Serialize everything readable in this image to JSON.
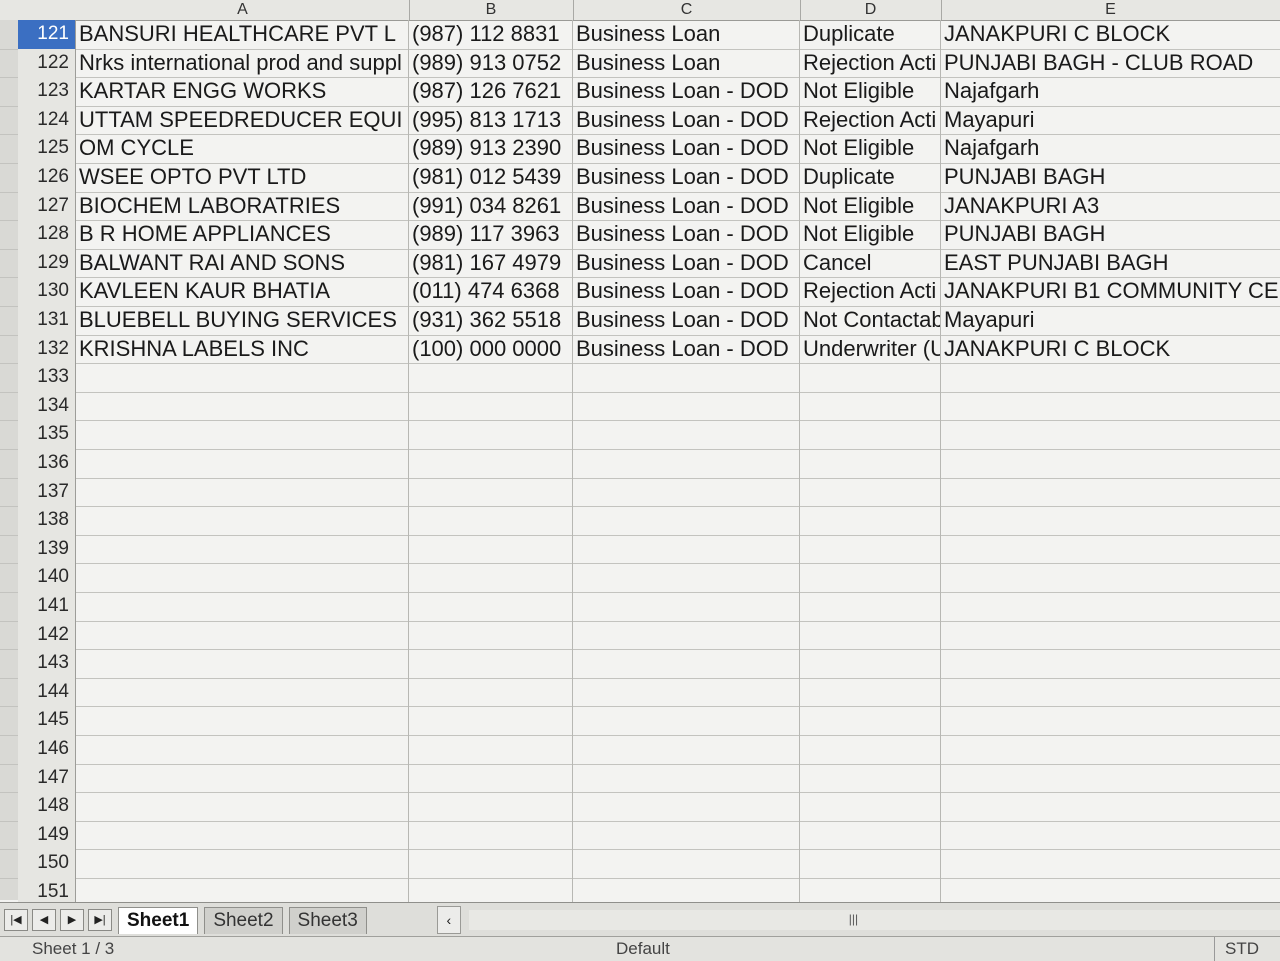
{
  "columns": [
    "A",
    "B",
    "C",
    "D",
    "E"
  ],
  "rows": [
    {
      "num": "121",
      "a": "BANSURI HEALTHCARE PVT L",
      "b": "(987) 112 8831",
      "c": "Business Loan",
      "d": "Duplicate",
      "e": "JANAKPURI C BLOCK",
      "active": true
    },
    {
      "num": "122",
      "a": "Nrks international prod and suppl",
      "b": "(989) 913 0752",
      "c": "Business Loan",
      "d": "Rejection Acti",
      "e": "PUNJABI BAGH - CLUB ROAD"
    },
    {
      "num": "123",
      "a": "KARTAR ENGG WORKS",
      "b": "(987) 126 7621",
      "c": "Business Loan - DOD",
      "d": "Not Eligible",
      "e": "Najafgarh"
    },
    {
      "num": "124",
      "a": "UTTAM SPEEDREDUCER EQUI",
      "b": "(995) 813 1713",
      "c": "Business Loan - DOD",
      "d": "Rejection Acti",
      "e": "Mayapuri"
    },
    {
      "num": "125",
      "a": "OM CYCLE",
      "b": "(989) 913 2390",
      "c": "Business Loan - DOD",
      "d": "Not Eligible",
      "e": "Najafgarh"
    },
    {
      "num": "126",
      "a": "WSEE OPTO PVT LTD",
      "b": "(981) 012 5439",
      "c": "Business Loan - DOD",
      "d": "Duplicate",
      "e": "PUNJABI BAGH"
    },
    {
      "num": "127",
      "a": "BIOCHEM LABORATRIES",
      "b": "(991) 034 8261",
      "c": "Business Loan - DOD",
      "d": "Not Eligible",
      "e": "JANAKPURI A3"
    },
    {
      "num": "128",
      "a": "B R HOME APPLIANCES",
      "b": "(989) 117 3963",
      "c": "Business Loan - DOD",
      "d": "Not Eligible",
      "e": "PUNJABI BAGH"
    },
    {
      "num": "129",
      "a": "BALWANT RAI AND SONS",
      "b": "(981) 167 4979",
      "c": "Business Loan - DOD",
      "d": "Cancel",
      "e": "EAST PUNJABI BAGH"
    },
    {
      "num": "130",
      "a": "KAVLEEN KAUR BHATIA",
      "b": "(011) 474 6368",
      "c": "Business Loan - DOD",
      "d": "Rejection Acti",
      "e": "JANAKPURI B1 COMMUNITY CENTE"
    },
    {
      "num": "131",
      "a": "BLUEBELL BUYING SERVICES",
      "b": "(931) 362 5518",
      "c": "Business Loan - DOD",
      "d": "Not Contactab",
      "e": "Mayapuri"
    },
    {
      "num": "132",
      "a": "KRISHNA LABELS INC",
      "b": "(100) 000 0000",
      "c": "Business Loan - DOD",
      "d": "Underwriter (U",
      "e": "JANAKPURI C BLOCK"
    },
    {
      "num": "133",
      "a": "",
      "b": "",
      "c": "",
      "d": "",
      "e": ""
    },
    {
      "num": "134",
      "a": "",
      "b": "",
      "c": "",
      "d": "",
      "e": ""
    },
    {
      "num": "135",
      "a": "",
      "b": "",
      "c": "",
      "d": "",
      "e": ""
    },
    {
      "num": "136",
      "a": "",
      "b": "",
      "c": "",
      "d": "",
      "e": ""
    },
    {
      "num": "137",
      "a": "",
      "b": "",
      "c": "",
      "d": "",
      "e": ""
    },
    {
      "num": "138",
      "a": "",
      "b": "",
      "c": "",
      "d": "",
      "e": ""
    },
    {
      "num": "139",
      "a": "",
      "b": "",
      "c": "",
      "d": "",
      "e": ""
    },
    {
      "num": "140",
      "a": "",
      "b": "",
      "c": "",
      "d": "",
      "e": ""
    },
    {
      "num": "141",
      "a": "",
      "b": "",
      "c": "",
      "d": "",
      "e": ""
    },
    {
      "num": "142",
      "a": "",
      "b": "",
      "c": "",
      "d": "",
      "e": ""
    },
    {
      "num": "143",
      "a": "",
      "b": "",
      "c": "",
      "d": "",
      "e": ""
    },
    {
      "num": "144",
      "a": "",
      "b": "",
      "c": "",
      "d": "",
      "e": ""
    },
    {
      "num": "145",
      "a": "",
      "b": "",
      "c": "",
      "d": "",
      "e": ""
    },
    {
      "num": "146",
      "a": "",
      "b": "",
      "c": "",
      "d": "",
      "e": ""
    },
    {
      "num": "147",
      "a": "",
      "b": "",
      "c": "",
      "d": "",
      "e": ""
    },
    {
      "num": "148",
      "a": "",
      "b": "",
      "c": "",
      "d": "",
      "e": ""
    },
    {
      "num": "149",
      "a": "",
      "b": "",
      "c": "",
      "d": "",
      "e": ""
    },
    {
      "num": "150",
      "a": "",
      "b": "",
      "c": "",
      "d": "",
      "e": ""
    },
    {
      "num": "151",
      "a": "",
      "b": "",
      "c": "",
      "d": "",
      "e": ""
    }
  ],
  "tabs": [
    "Sheet1",
    "Sheet2",
    "Sheet3"
  ],
  "active_tab": "Sheet1",
  "status": {
    "sheet": "Sheet 1 / 3",
    "page_style": "Default",
    "mode": "STD"
  },
  "colors": {
    "active_row": "#3b6fc2",
    "background": "#f3f3f1"
  }
}
